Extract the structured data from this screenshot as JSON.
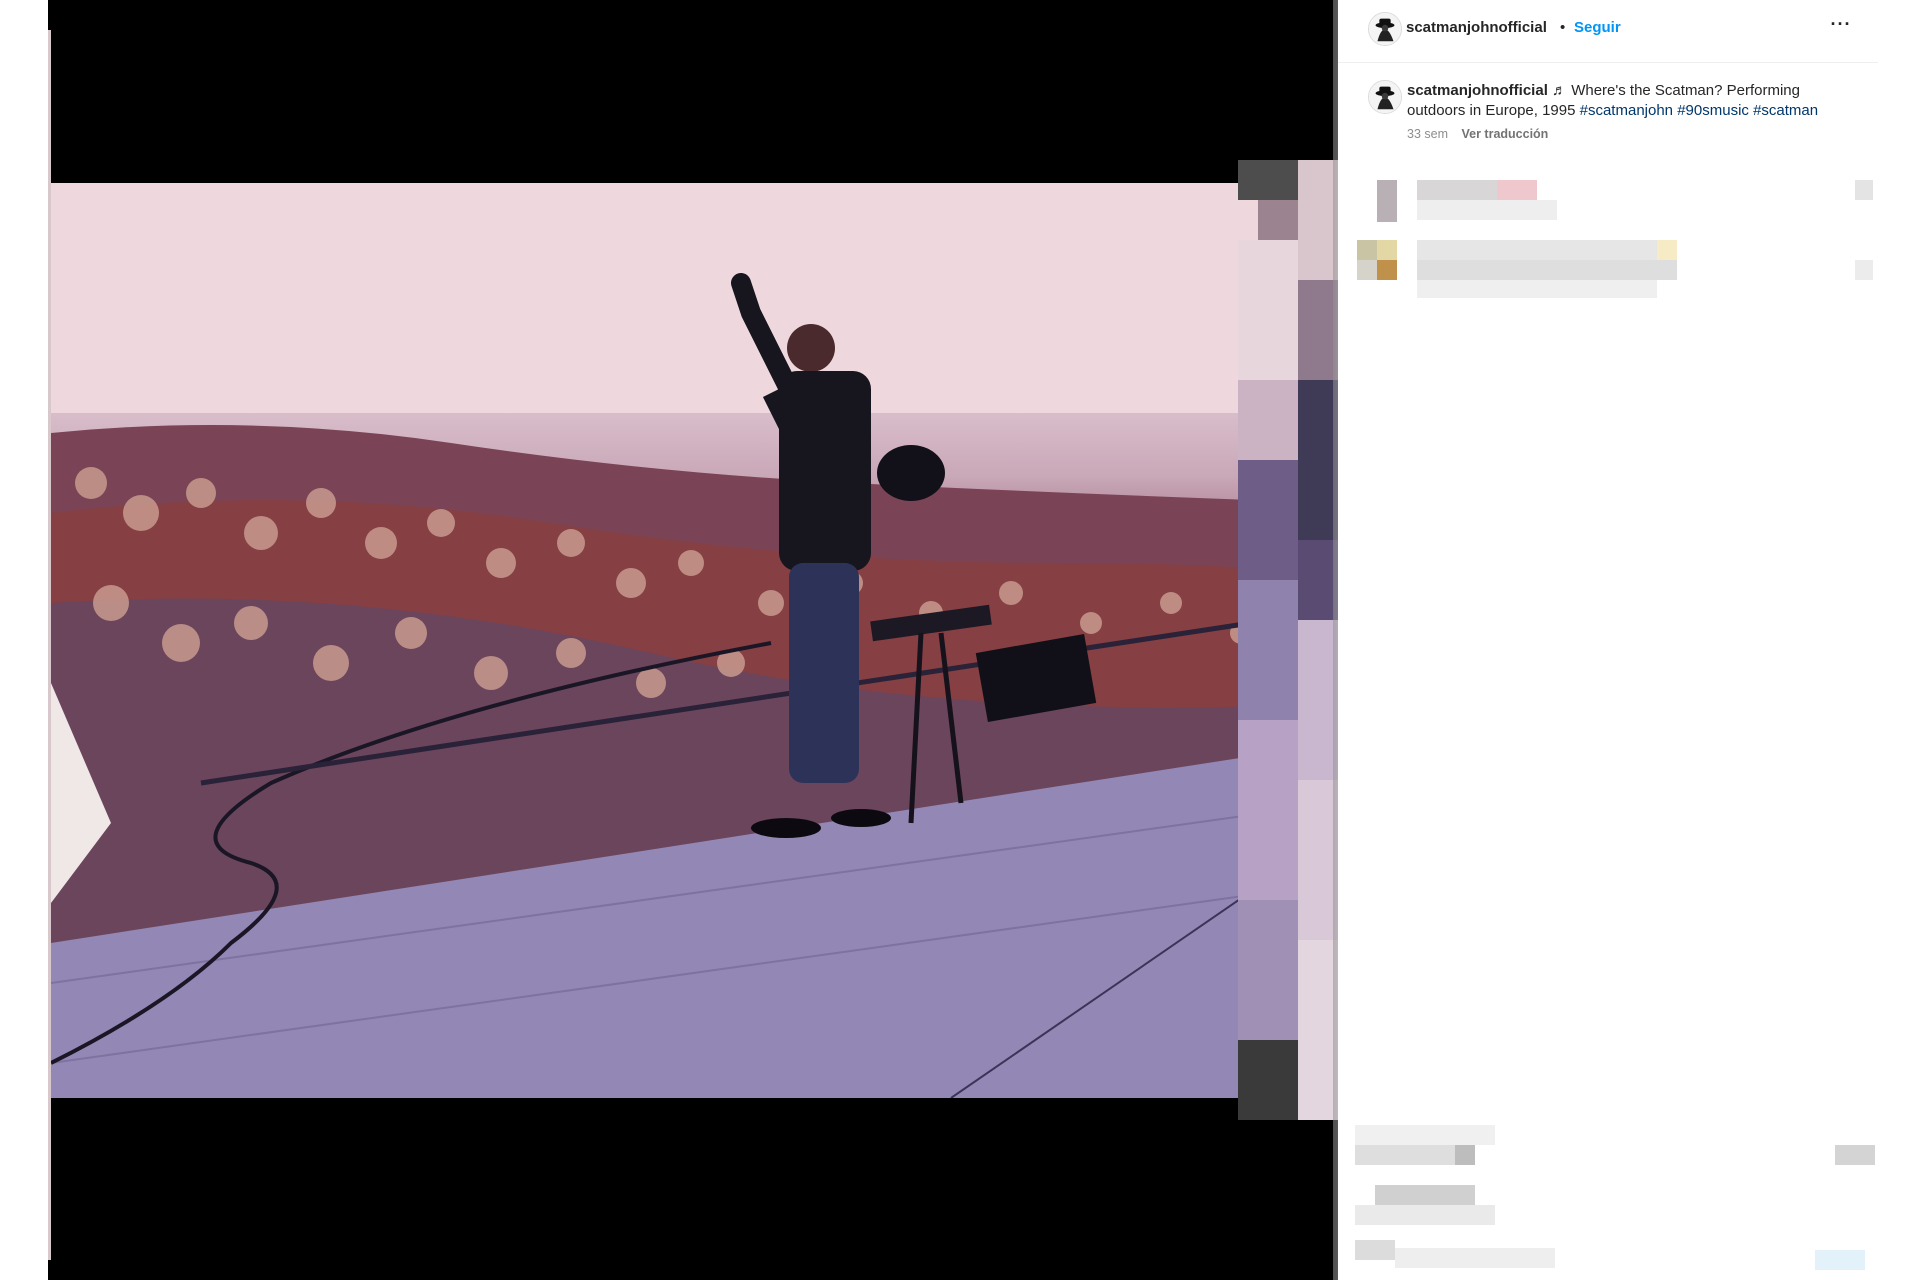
{
  "post": {
    "username": "scatmanjohnofficial",
    "separator": "•",
    "follow_label": "Seguir",
    "more_label": "···",
    "caption": {
      "username": "scatmanjohnofficial",
      "text_before": " ♬ Where's the Scatman? Performing outdoors in Europe, 1995 ",
      "hashtags": [
        "#scatmanjohn",
        "#90smusic",
        "#scatman"
      ],
      "time": "33 sem",
      "translate_label": "Ver traducción"
    }
  },
  "icons": {
    "avatar": "scatman-hat-avatar-icon",
    "more": "more-options-icon"
  },
  "colors": {
    "link_blue": "#0095f6",
    "hashtag_blue": "#00376b",
    "text": "#262626",
    "muted": "#8e8e8e"
  }
}
